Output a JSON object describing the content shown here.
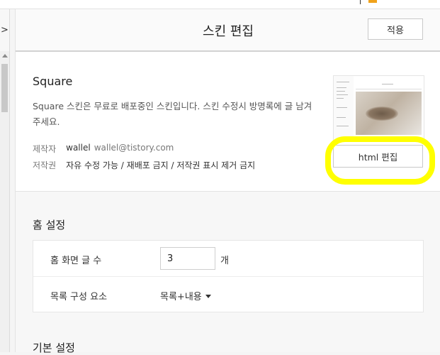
{
  "header": {
    "title": "스킨 편집",
    "apply_label": "적용"
  },
  "rail": {
    "toggle_icon": "chevron-right-icon",
    "toggle_glyph": ">"
  },
  "skin": {
    "name": "Square",
    "description": "Square 스킨은 무료로 배포중인 스킨입니다. 스킨 수정시 방명록에 글 남겨주세요.",
    "author_label": "제작자",
    "author_name": "wallel",
    "author_email": "wallel@tistory.com",
    "copyright_label": "저작권",
    "copyright_text": "자유 수정 가능 / 재배포 금지 / 저작권 표시 제거 금지",
    "html_edit_label": "html 편집"
  },
  "home_settings": {
    "title": "홈 설정",
    "post_count_label": "홈 화면 글 수",
    "post_count_value": "3",
    "post_count_unit": "개",
    "list_elements_label": "목록 구성 요소",
    "list_elements_value": "목록+내용"
  },
  "basic_settings": {
    "title": "기본 설정"
  },
  "colors": {
    "highlight": "#ffff00",
    "accent": "#f0a21b"
  }
}
